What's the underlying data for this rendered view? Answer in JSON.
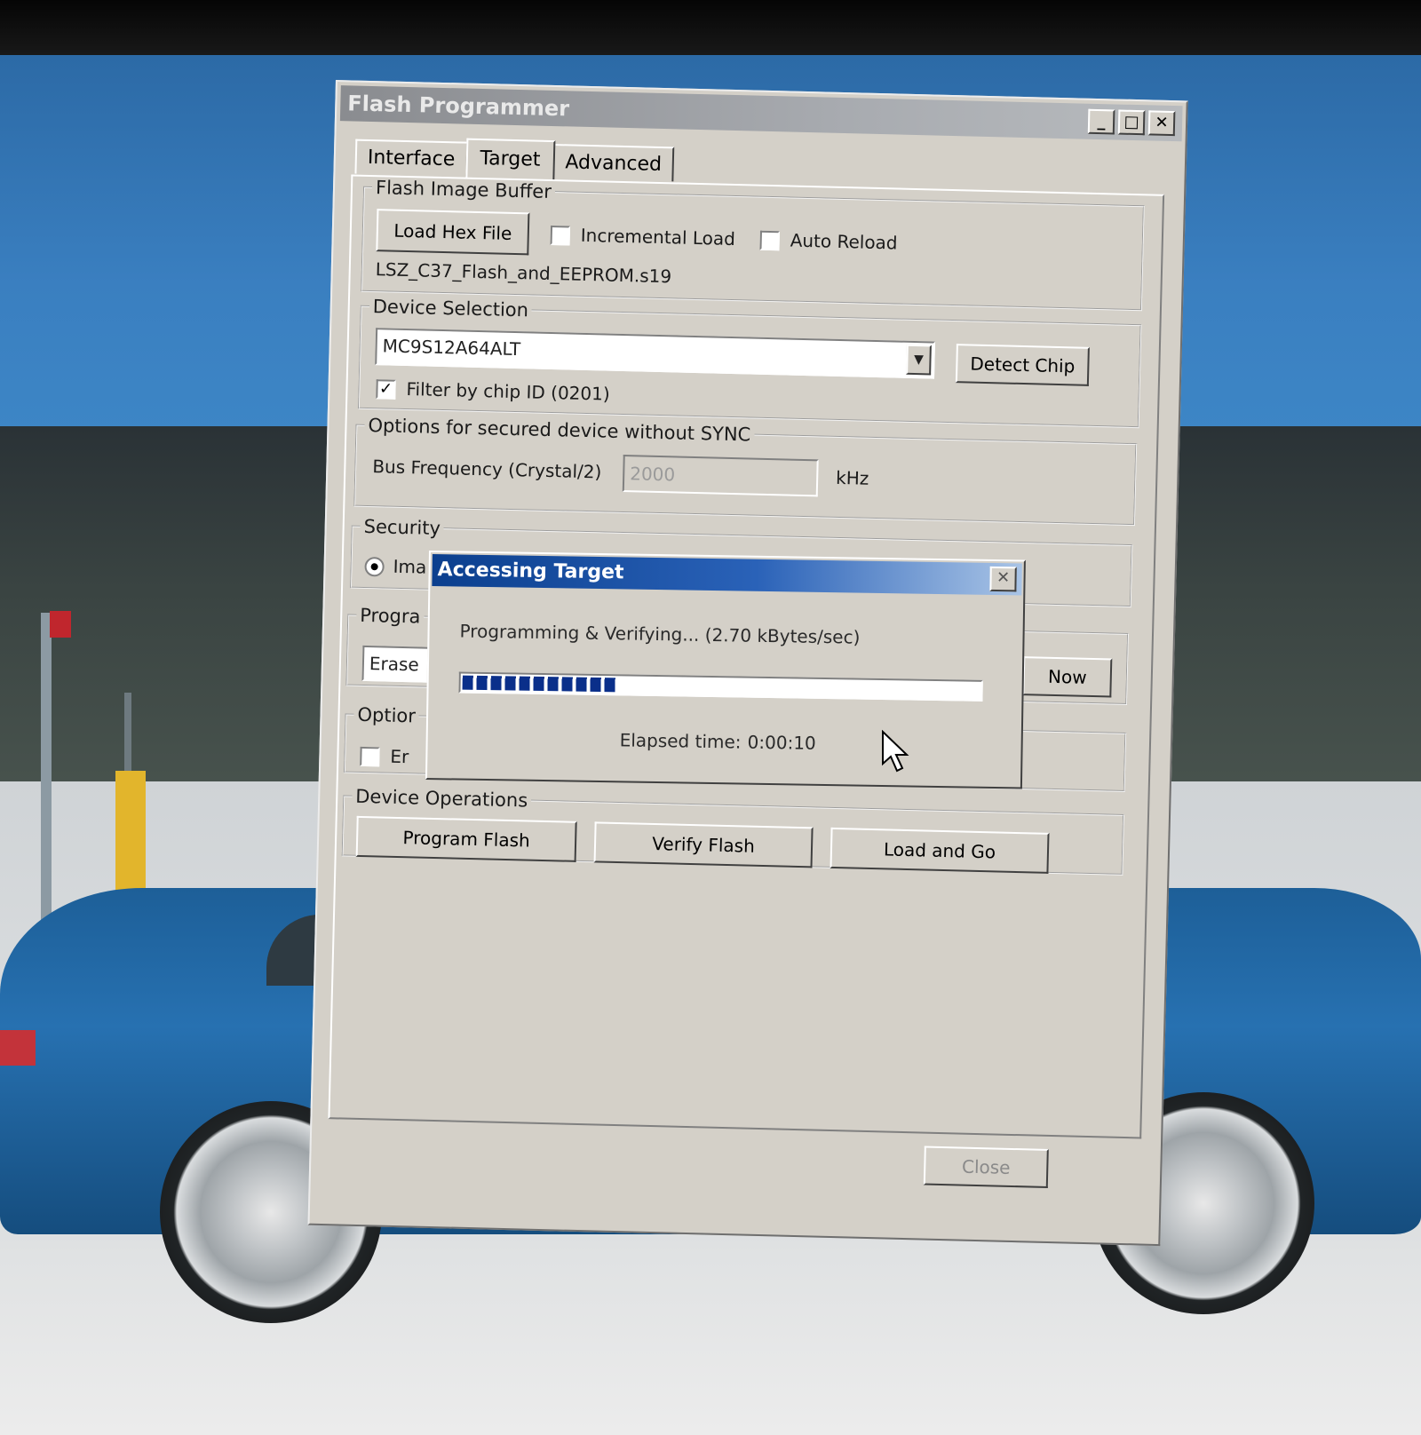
{
  "window": {
    "title": "Flash Programmer",
    "minimize": "_",
    "maximize": "□",
    "close": "✕"
  },
  "tabs": [
    {
      "label": "Interface"
    },
    {
      "label": "Target",
      "active": true
    },
    {
      "label": "Advanced"
    }
  ],
  "flash_image_buffer": {
    "legend": "Flash Image Buffer",
    "load_button": "Load Hex File",
    "incremental_load_label": "Incremental Load",
    "incremental_load_checked": false,
    "auto_reload_label": "Auto Reload",
    "auto_reload_checked": false,
    "filename": "LSZ_C37_Flash_and_EEPROM.s19"
  },
  "device_selection": {
    "legend": "Device Selection",
    "selected_device": "MC9S12A64ALT",
    "detect_button": "Detect Chip",
    "filter_label": "Filter by chip ID (0201)",
    "filter_checked": true
  },
  "secured_options": {
    "legend": "Options for secured device without SYNC",
    "bus_freq_label": "Bus Frequency (Crystal/2)",
    "bus_freq_value": "2000",
    "unit": "kHz"
  },
  "security": {
    "legend": "Security",
    "radio_label_visible": "Ima"
  },
  "program_group": {
    "legend_visible": "Progra",
    "erase_visible": "Erase",
    "now_button_visible": "Now"
  },
  "options_group": {
    "legend_visible": "Optior",
    "check_label_visible": "Er"
  },
  "device_operations": {
    "legend": "Device Operations",
    "program_button": "Program Flash",
    "verify_button": "Verify Flash",
    "load_go_button": "Load and Go"
  },
  "footer": {
    "close_button": "Close"
  },
  "progress_dialog": {
    "title": "Accessing Target",
    "close": "✕",
    "status": "Programming & Verifying... (2.70 kBytes/sec)",
    "progress_fraction": 0.3,
    "elapsed_label": "Elapsed time:",
    "elapsed_value": "0:00:10"
  },
  "colors": {
    "dialog_title": "#0b3f8e",
    "progress_fill": "#0a2f8a",
    "window_face": "#d4d0c8"
  }
}
